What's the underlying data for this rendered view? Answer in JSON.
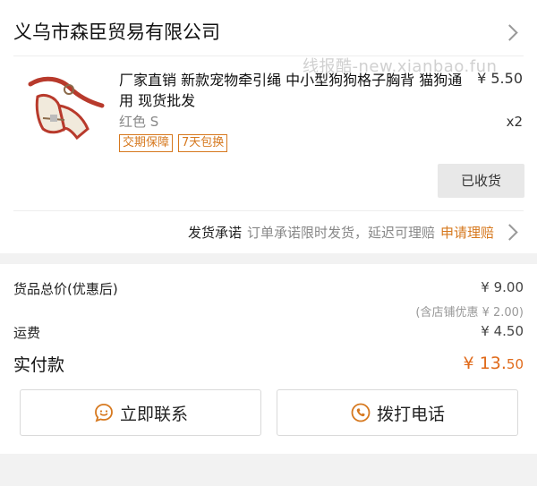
{
  "store": {
    "name": "义乌市森臣贸易有限公司"
  },
  "watermark": "线报酷-new.xianbao.fun",
  "product": {
    "title": "厂家直销 新款宠物牵引绳 中小型狗狗格子胸背 猫狗通用 现货批发",
    "price": "¥ 5.50",
    "spec": "红色 S",
    "quantity": "x2",
    "tags": [
      "交期保障",
      "7天包换"
    ],
    "action_label": "已收货"
  },
  "promise": {
    "label": "发货承诺",
    "description": "订单承诺限时发货，延迟可理赔",
    "link": "申请理赔"
  },
  "summary": {
    "goods_total_label": "货品总价(优惠后)",
    "goods_total_value": "¥ 9.00",
    "discount_note": "(含店铺优惠 ¥ 2.00)",
    "shipping_label": "运费",
    "shipping_value": "¥ 4.50",
    "paid_label": "实付款",
    "paid_symbol": "¥ ",
    "paid_integer": "13.",
    "paid_decimal": "50"
  },
  "actions": {
    "contact_now": "立即联系",
    "call_phone": "拨打电话"
  },
  "colors": {
    "accent": "#d6781e",
    "price_accent": "#e06a1a"
  }
}
